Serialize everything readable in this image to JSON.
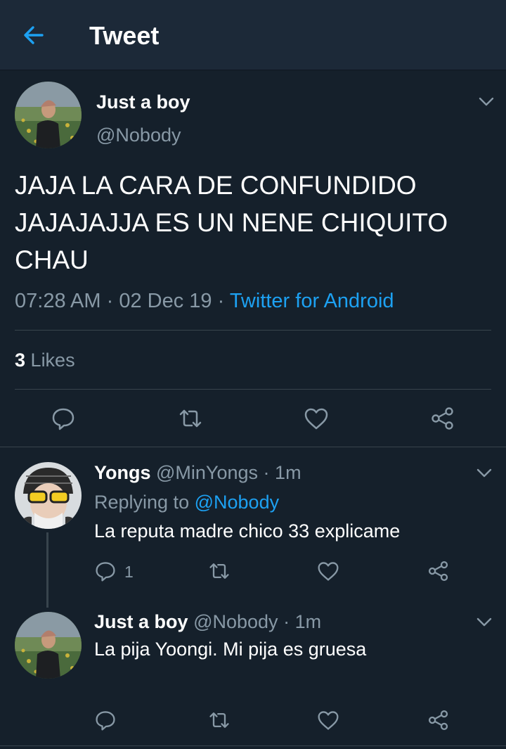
{
  "header": {
    "title": "Tweet"
  },
  "main_tweet": {
    "display_name": "Just a boy",
    "handle": "@Nobody",
    "text_lines": [
      "JAJA LA CARA DE CONFUNDIDO",
      "JAJAJAJJA ES UN NENE CHIQUITO",
      "CHAU"
    ],
    "time": "07:28 AM",
    "sep1": "·",
    "date": "02 Dec 19",
    "sep2": "·",
    "source": "Twitter for Android",
    "likes_count": "3",
    "likes_label": "Likes"
  },
  "replies": [
    {
      "display_name": "Yongs",
      "handle": "@MinYongs",
      "sep": "·",
      "time": "1m",
      "replying_prefix": "Replying to",
      "replying_handle": "@Nobody",
      "text": "La reputa madre chico 33 explicame",
      "reply_count": "1"
    },
    {
      "display_name": "Just a boy",
      "handle": "@Nobody",
      "sep": "·",
      "time": "1m",
      "text": "La pija Yoongi. Mi pija es gruesa"
    }
  ],
  "colors": {
    "background": "#15202b",
    "header": "#1c2938",
    "accent": "#1da1f2",
    "muted": "#8899a6",
    "divider": "#38444d"
  }
}
